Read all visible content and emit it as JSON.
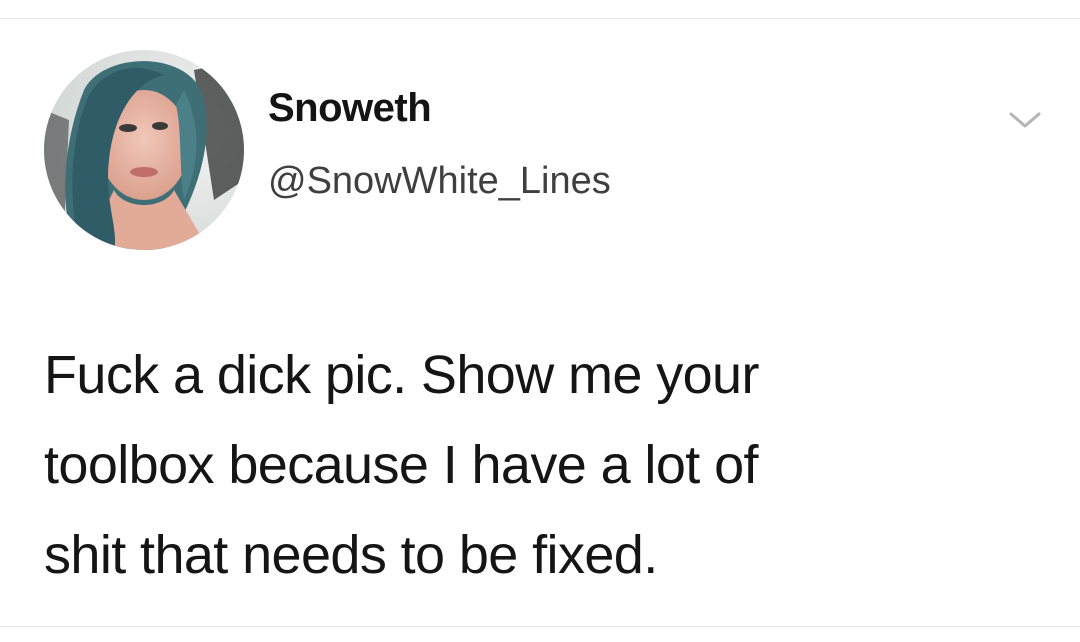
{
  "tweet": {
    "display_name": "Snoweth",
    "handle": "@SnowWhite_Lines",
    "text_lines": [
      "Fuck a dick pic. Show me your",
      "toolbox because I have a lot of",
      "shit that needs to be fixed."
    ]
  },
  "icons": {
    "menu": "chevron-down-icon",
    "profile": "avatar-photo"
  },
  "colors": {
    "background": "#ffffff",
    "text": "#151515",
    "handle": "#3f3f3f",
    "chevron": "#b5b5b5",
    "hair": "#3e6e76"
  }
}
